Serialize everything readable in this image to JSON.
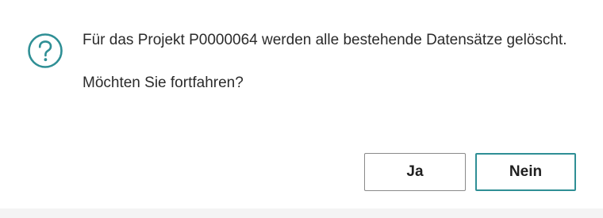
{
  "dialog": {
    "icon": "question-icon",
    "accent_color": "#2f8f95",
    "message_line": "Für das Projekt P0000064 werden alle bestehende Datensätze gelöscht.",
    "question": "Möchten Sie fortfahren?",
    "buttons": {
      "yes_label": "Ja",
      "no_label": "Nein"
    }
  }
}
